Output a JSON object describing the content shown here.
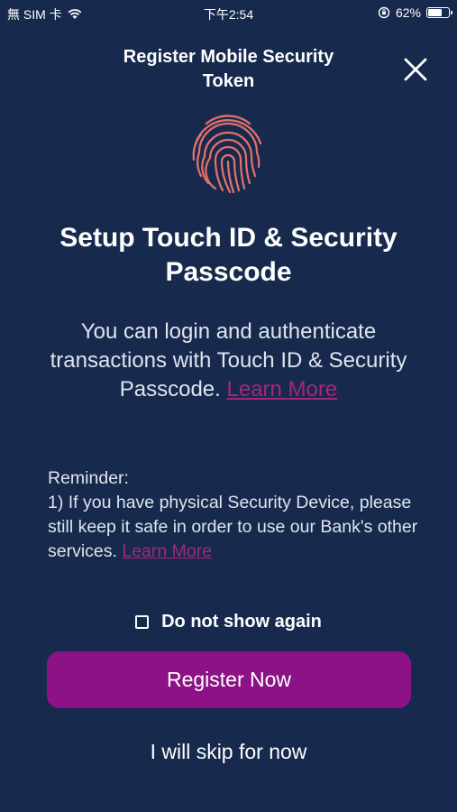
{
  "status_bar": {
    "carrier": "無 SIM 卡",
    "time": "下午2:54",
    "battery": "62%",
    "battery_level": 0.62
  },
  "header": {
    "title": "Register Mobile Security Token",
    "close_icon": "close-icon"
  },
  "hero": {
    "icon": "fingerprint-icon",
    "accent": "#e0706a"
  },
  "main": {
    "title": "Setup Touch ID &  Security Passcode",
    "description": "You can login and authenticate transactions with Touch ID & Security Passcode.",
    "description_link": "Learn More",
    "reminder_heading": "Reminder:",
    "reminder_text": "1) If you have physical Security Device, please still keep it safe in order to use our Bank's other services.",
    "reminder_link": "Learn More"
  },
  "checkbox": {
    "label": "Do not show again",
    "checked": false
  },
  "buttons": {
    "register": "Register Now",
    "skip": "I will skip for now"
  },
  "colors": {
    "background": "#172a4d",
    "primary_button": "#8c1285",
    "link": "#a4267f"
  }
}
